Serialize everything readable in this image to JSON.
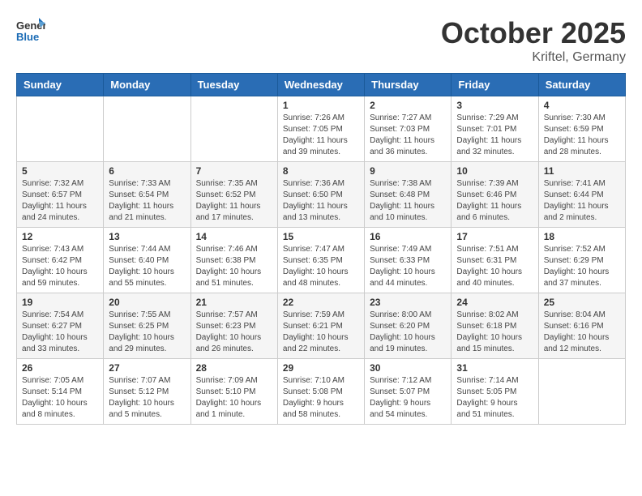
{
  "header": {
    "logo_general": "General",
    "logo_blue": "Blue",
    "month": "October 2025",
    "location": "Kriftel, Germany"
  },
  "weekdays": [
    "Sunday",
    "Monday",
    "Tuesday",
    "Wednesday",
    "Thursday",
    "Friday",
    "Saturday"
  ],
  "weeks": [
    [
      {
        "day": "",
        "info": ""
      },
      {
        "day": "",
        "info": ""
      },
      {
        "day": "",
        "info": ""
      },
      {
        "day": "1",
        "info": "Sunrise: 7:26 AM\nSunset: 7:05 PM\nDaylight: 11 hours\nand 39 minutes."
      },
      {
        "day": "2",
        "info": "Sunrise: 7:27 AM\nSunset: 7:03 PM\nDaylight: 11 hours\nand 36 minutes."
      },
      {
        "day": "3",
        "info": "Sunrise: 7:29 AM\nSunset: 7:01 PM\nDaylight: 11 hours\nand 32 minutes."
      },
      {
        "day": "4",
        "info": "Sunrise: 7:30 AM\nSunset: 6:59 PM\nDaylight: 11 hours\nand 28 minutes."
      }
    ],
    [
      {
        "day": "5",
        "info": "Sunrise: 7:32 AM\nSunset: 6:57 PM\nDaylight: 11 hours\nand 24 minutes."
      },
      {
        "day": "6",
        "info": "Sunrise: 7:33 AM\nSunset: 6:54 PM\nDaylight: 11 hours\nand 21 minutes."
      },
      {
        "day": "7",
        "info": "Sunrise: 7:35 AM\nSunset: 6:52 PM\nDaylight: 11 hours\nand 17 minutes."
      },
      {
        "day": "8",
        "info": "Sunrise: 7:36 AM\nSunset: 6:50 PM\nDaylight: 11 hours\nand 13 minutes."
      },
      {
        "day": "9",
        "info": "Sunrise: 7:38 AM\nSunset: 6:48 PM\nDaylight: 11 hours\nand 10 minutes."
      },
      {
        "day": "10",
        "info": "Sunrise: 7:39 AM\nSunset: 6:46 PM\nDaylight: 11 hours\nand 6 minutes."
      },
      {
        "day": "11",
        "info": "Sunrise: 7:41 AM\nSunset: 6:44 PM\nDaylight: 11 hours\nand 2 minutes."
      }
    ],
    [
      {
        "day": "12",
        "info": "Sunrise: 7:43 AM\nSunset: 6:42 PM\nDaylight: 10 hours\nand 59 minutes."
      },
      {
        "day": "13",
        "info": "Sunrise: 7:44 AM\nSunset: 6:40 PM\nDaylight: 10 hours\nand 55 minutes."
      },
      {
        "day": "14",
        "info": "Sunrise: 7:46 AM\nSunset: 6:38 PM\nDaylight: 10 hours\nand 51 minutes."
      },
      {
        "day": "15",
        "info": "Sunrise: 7:47 AM\nSunset: 6:35 PM\nDaylight: 10 hours\nand 48 minutes."
      },
      {
        "day": "16",
        "info": "Sunrise: 7:49 AM\nSunset: 6:33 PM\nDaylight: 10 hours\nand 44 minutes."
      },
      {
        "day": "17",
        "info": "Sunrise: 7:51 AM\nSunset: 6:31 PM\nDaylight: 10 hours\nand 40 minutes."
      },
      {
        "day": "18",
        "info": "Sunrise: 7:52 AM\nSunset: 6:29 PM\nDaylight: 10 hours\nand 37 minutes."
      }
    ],
    [
      {
        "day": "19",
        "info": "Sunrise: 7:54 AM\nSunset: 6:27 PM\nDaylight: 10 hours\nand 33 minutes."
      },
      {
        "day": "20",
        "info": "Sunrise: 7:55 AM\nSunset: 6:25 PM\nDaylight: 10 hours\nand 29 minutes."
      },
      {
        "day": "21",
        "info": "Sunrise: 7:57 AM\nSunset: 6:23 PM\nDaylight: 10 hours\nand 26 minutes."
      },
      {
        "day": "22",
        "info": "Sunrise: 7:59 AM\nSunset: 6:21 PM\nDaylight: 10 hours\nand 22 minutes."
      },
      {
        "day": "23",
        "info": "Sunrise: 8:00 AM\nSunset: 6:20 PM\nDaylight: 10 hours\nand 19 minutes."
      },
      {
        "day": "24",
        "info": "Sunrise: 8:02 AM\nSunset: 6:18 PM\nDaylight: 10 hours\nand 15 minutes."
      },
      {
        "day": "25",
        "info": "Sunrise: 8:04 AM\nSunset: 6:16 PM\nDaylight: 10 hours\nand 12 minutes."
      }
    ],
    [
      {
        "day": "26",
        "info": "Sunrise: 7:05 AM\nSunset: 5:14 PM\nDaylight: 10 hours\nand 8 minutes."
      },
      {
        "day": "27",
        "info": "Sunrise: 7:07 AM\nSunset: 5:12 PM\nDaylight: 10 hours\nand 5 minutes."
      },
      {
        "day": "28",
        "info": "Sunrise: 7:09 AM\nSunset: 5:10 PM\nDaylight: 10 hours\nand 1 minute."
      },
      {
        "day": "29",
        "info": "Sunrise: 7:10 AM\nSunset: 5:08 PM\nDaylight: 9 hours\nand 58 minutes."
      },
      {
        "day": "30",
        "info": "Sunrise: 7:12 AM\nSunset: 5:07 PM\nDaylight: 9 hours\nand 54 minutes."
      },
      {
        "day": "31",
        "info": "Sunrise: 7:14 AM\nSunset: 5:05 PM\nDaylight: 9 hours\nand 51 minutes."
      },
      {
        "day": "",
        "info": ""
      }
    ]
  ]
}
